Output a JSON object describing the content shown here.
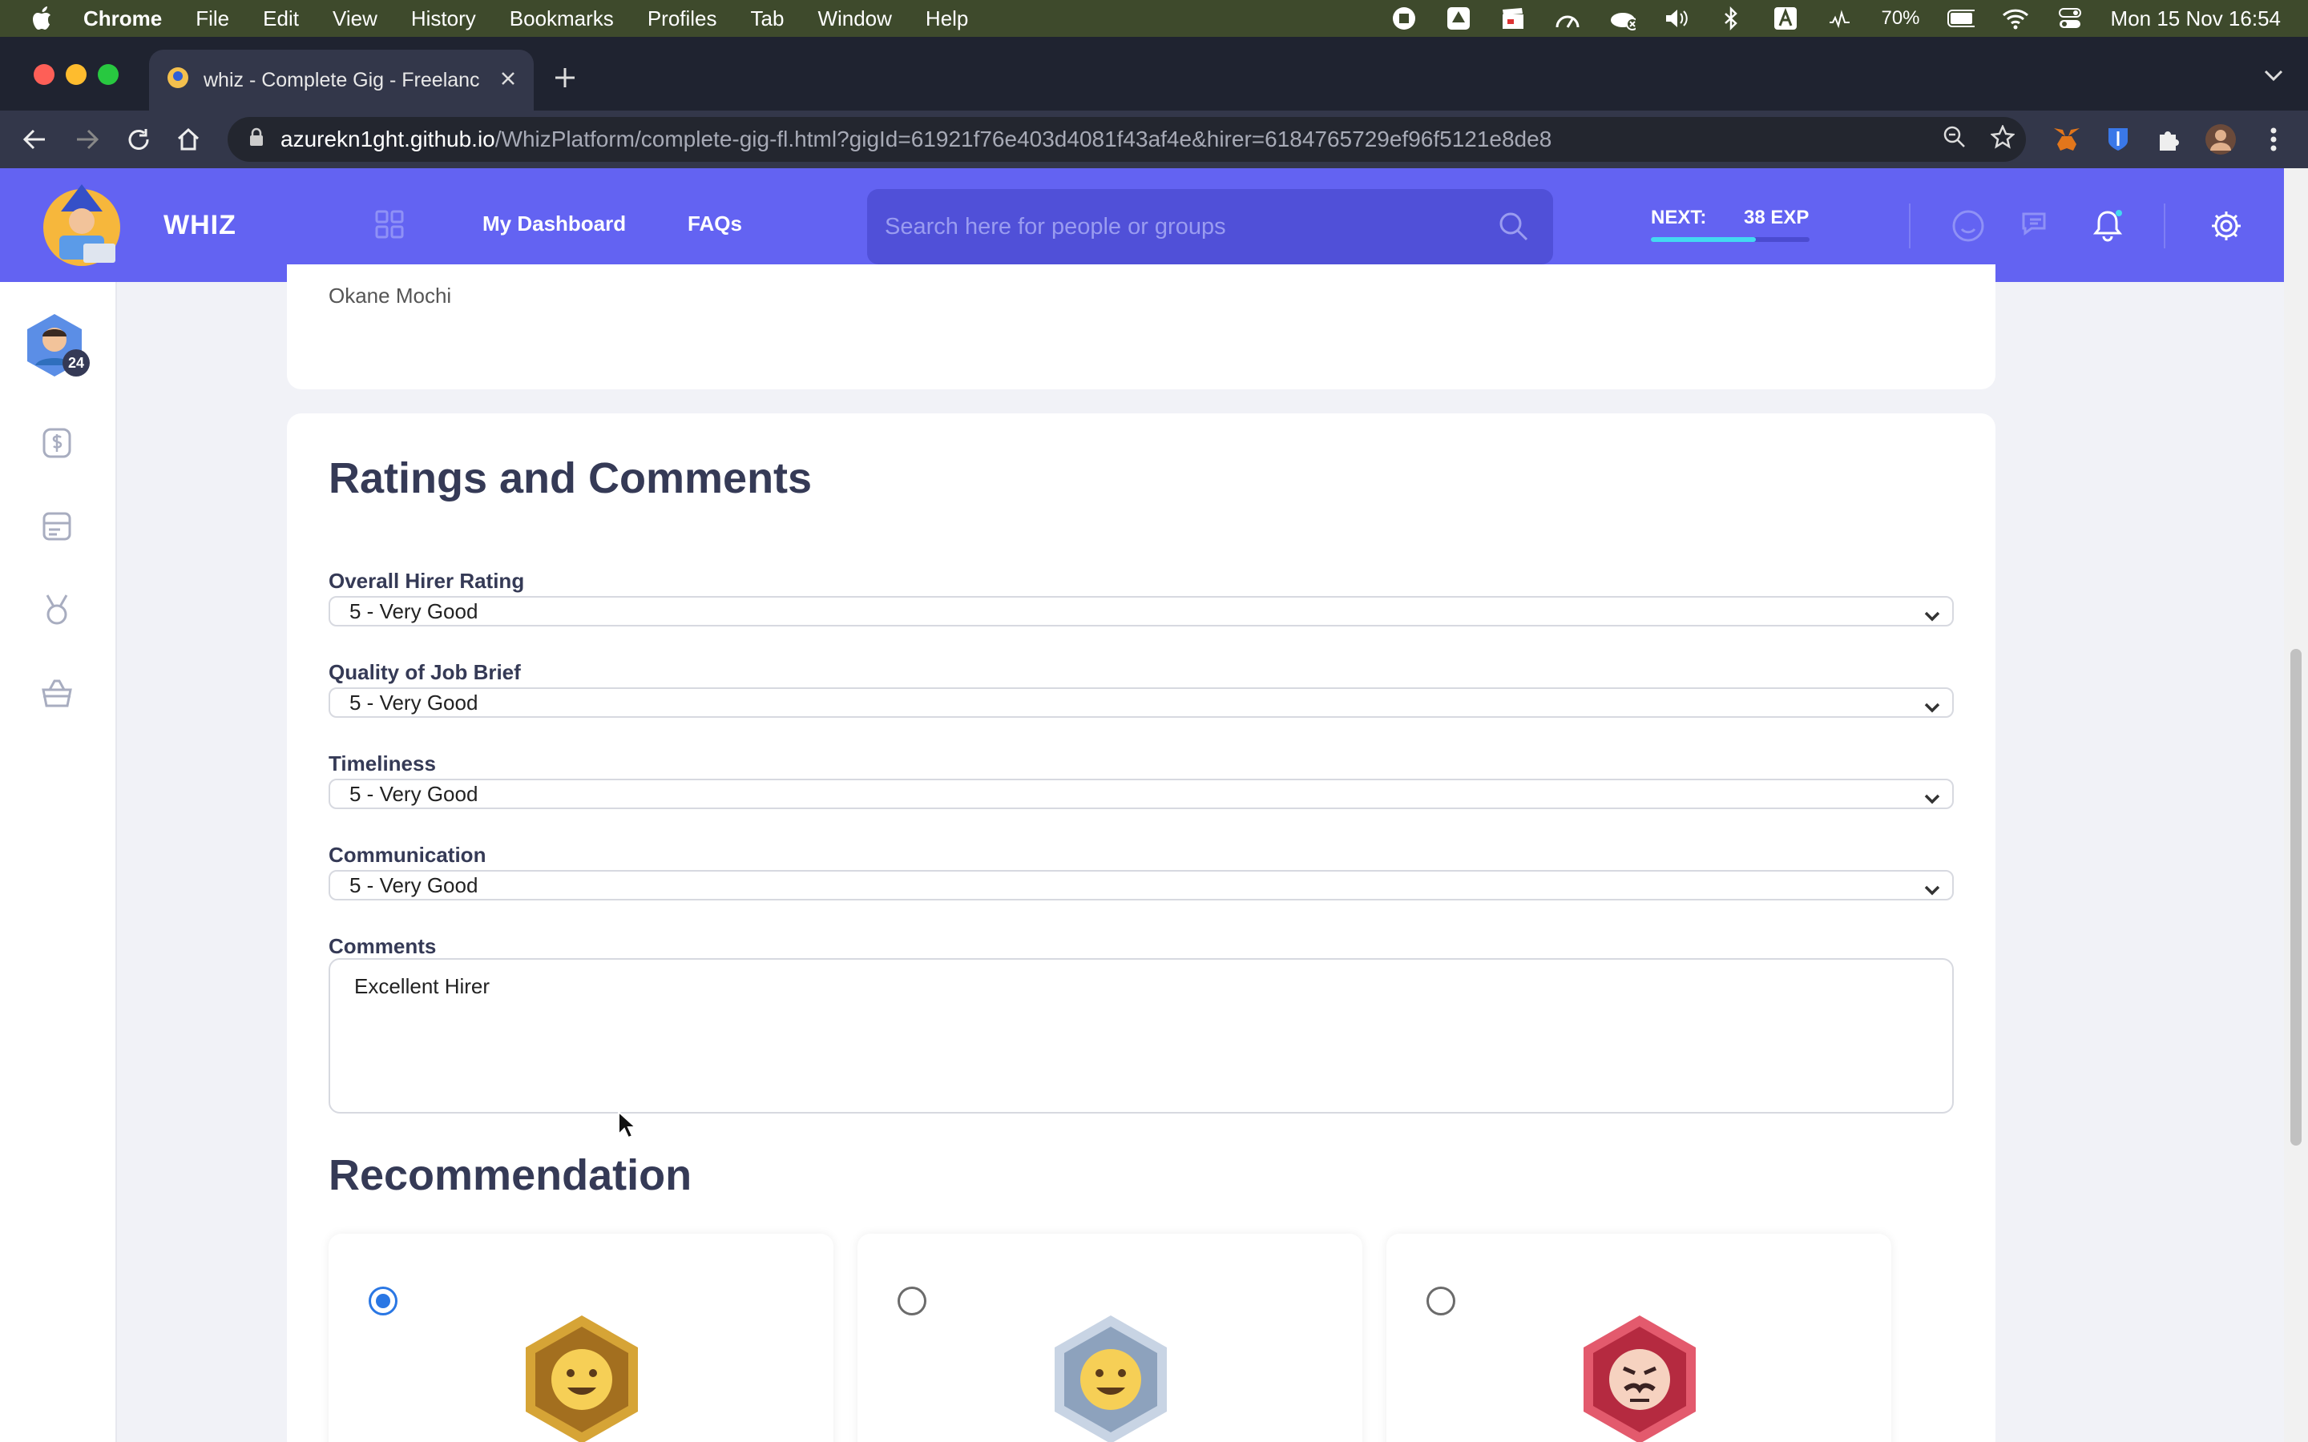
{
  "menubar": {
    "app": "Chrome",
    "items": [
      "File",
      "Edit",
      "View",
      "History",
      "Bookmarks",
      "Profiles",
      "Tab",
      "Window",
      "Help"
    ],
    "battery": "70%",
    "datetime": "Mon 15 Nov  16:54"
  },
  "browser": {
    "tab_title": "whiz - Complete Gig - Freelanc",
    "url_host": "azurekn1ght.github.io",
    "url_path": "/WhizPlatform/complete-gig-fl.html?gigId=61921f76e403d4081f43af4e&hirer=6184765729ef96f5121e8de8"
  },
  "header": {
    "brand": "WHIZ",
    "nav": [
      "My Dashboard",
      "FAQs"
    ],
    "search_placeholder": "Search here for people or groups",
    "next_label": "NEXT:",
    "exp_label": "38 EXP",
    "exp_progress": 0.66
  },
  "sidebar": {
    "level": "24"
  },
  "previous": {
    "name": "Okane Mochi"
  },
  "ratings": {
    "title": "Ratings and Comments",
    "fields": [
      {
        "label": "Overall Hirer Rating",
        "value": "5 - Very Good"
      },
      {
        "label": "Quality of Job Brief",
        "value": "5 - Very Good"
      },
      {
        "label": "Timeliness",
        "value": "5 - Very Good"
      },
      {
        "label": "Communication",
        "value": "5 - Very Good"
      }
    ],
    "comments_label": "Comments",
    "comments_value": "Excellent Hirer"
  },
  "recommendation": {
    "title": "Recommendation",
    "options": [
      {
        "selected": true,
        "color": "#c68a2c"
      },
      {
        "selected": false,
        "color": "#8da2bd"
      },
      {
        "selected": false,
        "color": "#c7334a"
      }
    ]
  },
  "colors": {
    "header": "#6363f2",
    "accent": "#2a77e4",
    "heading": "#353a56"
  }
}
